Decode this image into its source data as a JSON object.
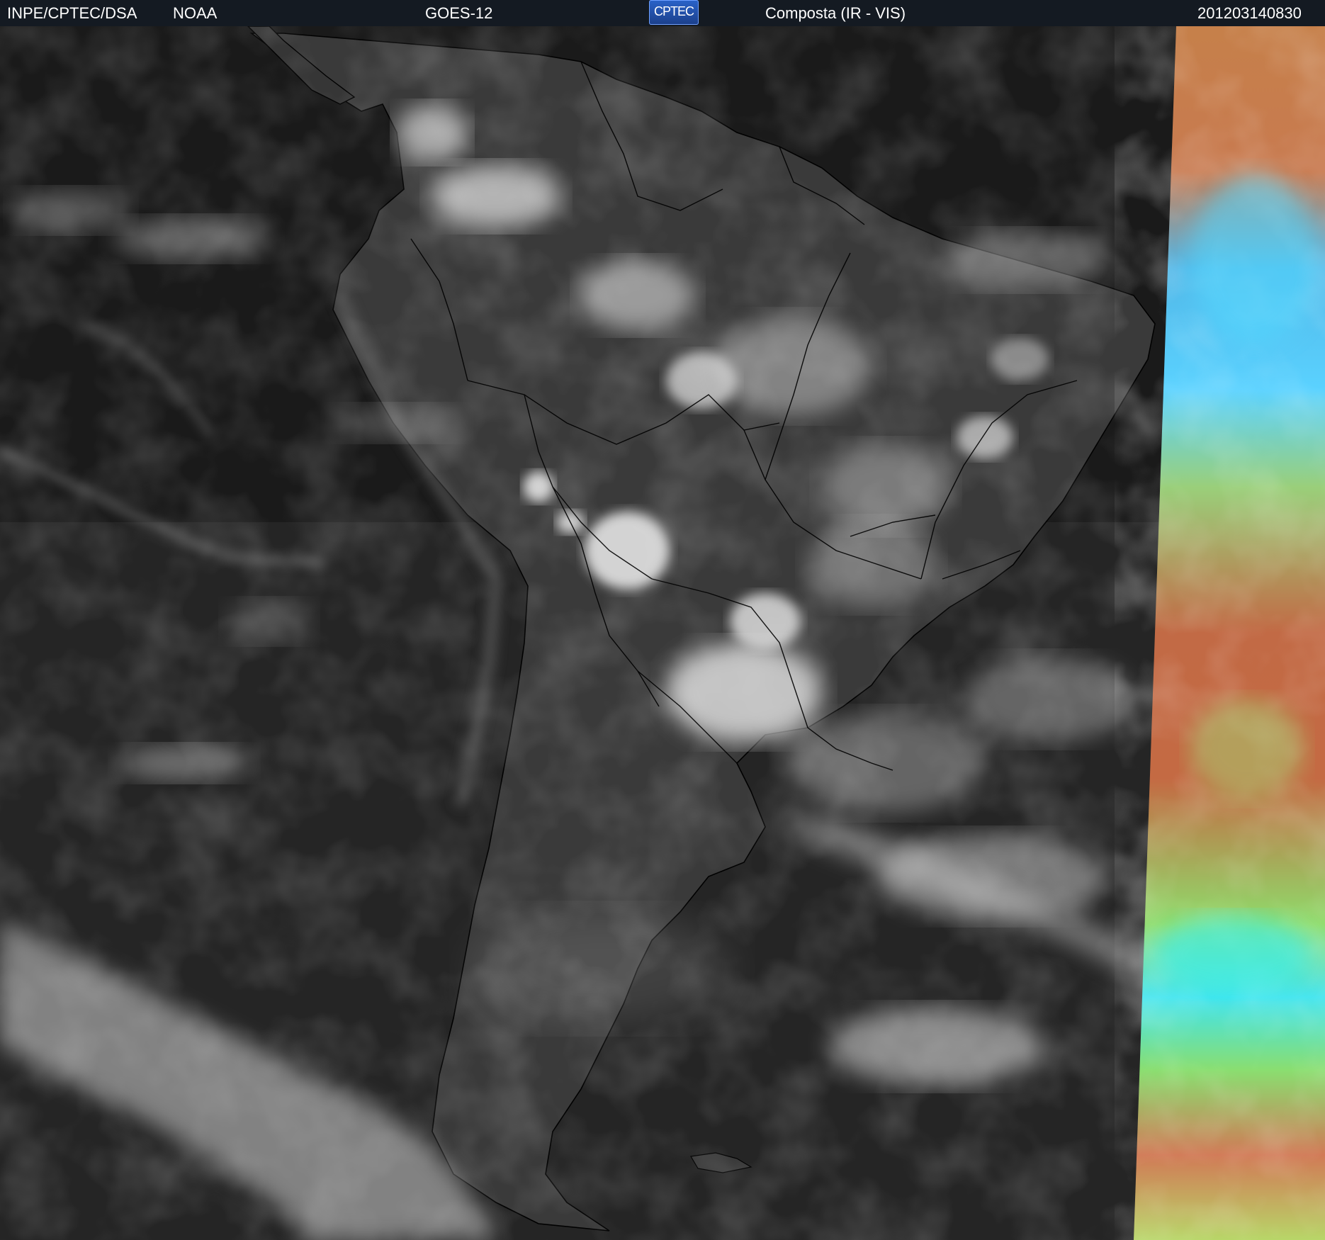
{
  "header": {
    "agency": "INPE/CPTEC/DSA",
    "source": "NOAA",
    "satellite": "GOES-12",
    "logo_text": "CPTEC",
    "product": "Composta (IR - VIS)",
    "timestamp": "201203140830"
  },
  "colors": {
    "header_bg": "#141a22",
    "ocean_dark": "#1b1b1b",
    "land_gray": "#3c3c3c",
    "cloud_white": "#e8e8e8",
    "border_lines": "#000000",
    "vis_orange": "#c86a3c",
    "vis_cyan": "#3ee6f0",
    "vis_green": "#8ee06a"
  },
  "map": {
    "region": "South America",
    "layers": [
      "infrared-grayscale",
      "visible-colour-strip",
      "political-borders"
    ]
  }
}
